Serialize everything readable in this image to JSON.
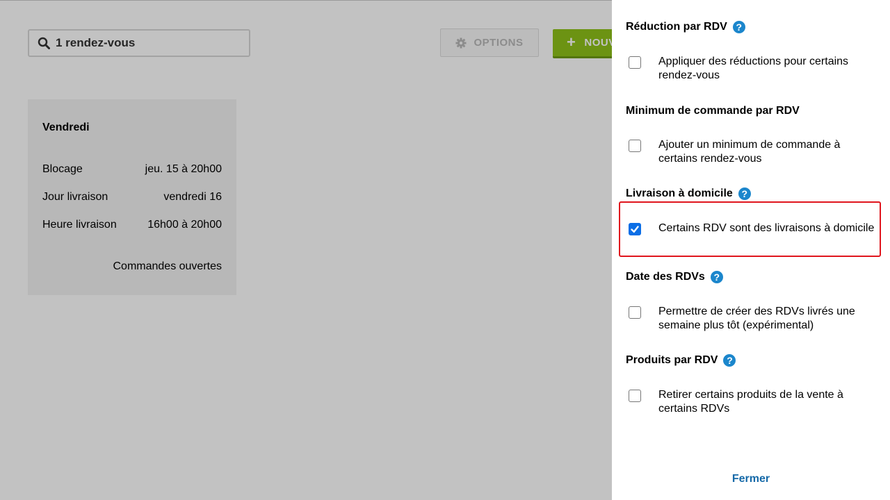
{
  "search": {
    "value": "1 rendez-vous"
  },
  "toolbar": {
    "options_label": "OPTIONS",
    "new_label": "NOUV"
  },
  "card": {
    "day": "Vendredi",
    "rows": [
      {
        "label": "Blocage",
        "value": "jeu. 15 à 20h00"
      },
      {
        "label": "Jour livraison",
        "value": "vendredi 16"
      },
      {
        "label": "Heure livraison",
        "value": "16h00 à 20h00"
      }
    ],
    "status": "Commandes ouvertes"
  },
  "panel": {
    "sections": [
      {
        "title": "Réduction par RDV",
        "help": true,
        "option": "Appliquer des réductions pour certains rendez-vous",
        "checked": false
      },
      {
        "title": "Minimum de commande par RDV",
        "help": false,
        "option": "Ajouter un minimum de commande à certains rendez-vous",
        "checked": false
      },
      {
        "title": "Livraison à domicile",
        "help": true,
        "option": "Certains RDV sont des livraisons à domicile",
        "checked": true
      },
      {
        "title": "Date des RDVs",
        "help": true,
        "option": "Permettre de créer des RDVs livrés une semaine plus tôt (expérimental)",
        "checked": false
      },
      {
        "title": "Produits par RDV",
        "help": true,
        "option": "Retirer certains produits de la vente à certains RDVs",
        "checked": false
      }
    ],
    "help_glyph": "?",
    "close_label": "Fermer"
  },
  "colors": {
    "accent_green": "#8ec21a",
    "help_blue": "#1b86cc",
    "checkbox_blue": "#0b6ee6",
    "highlight_red": "#e0151d",
    "link_blue": "#1569a8"
  }
}
